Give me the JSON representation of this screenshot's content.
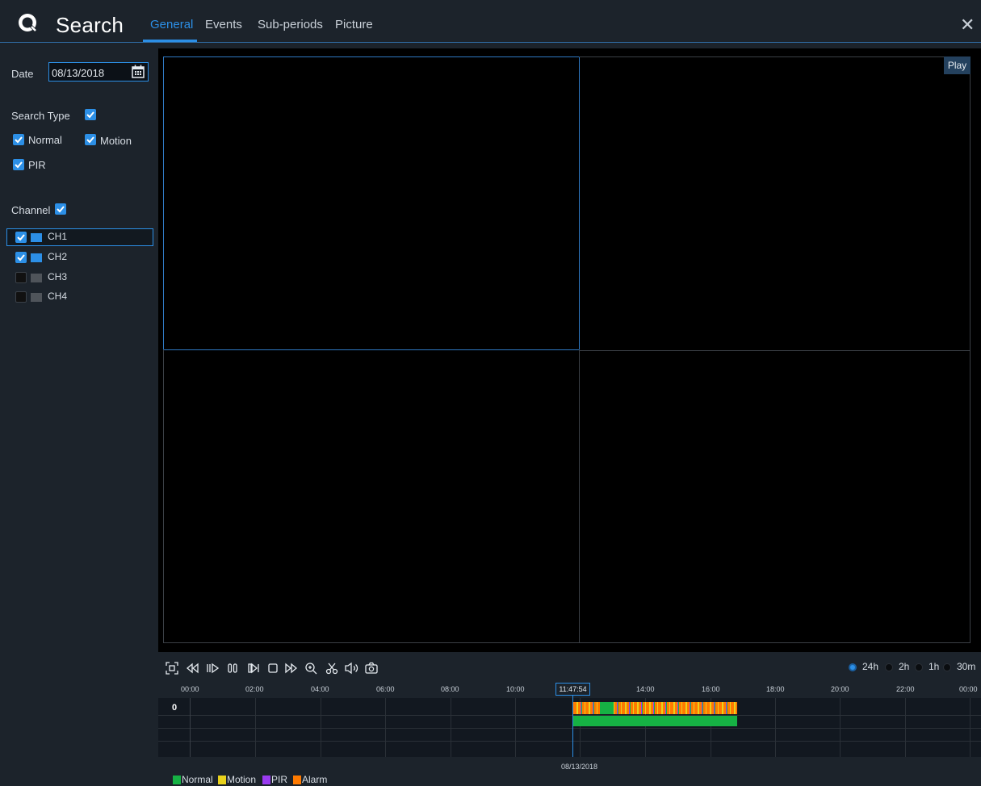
{
  "header": {
    "title": "Search",
    "tabs": [
      "General",
      "Events",
      "Sub-periods",
      "Picture"
    ],
    "active_tab": "General",
    "close_symbol": "✕"
  },
  "sidebar": {
    "date_label": "Date",
    "date_value": "08/13/2018",
    "search_type_label": "Search Type",
    "search_type_checked": true,
    "types": [
      {
        "label": "Normal",
        "checked": true
      },
      {
        "label": "Motion",
        "checked": true
      },
      {
        "label": "PIR",
        "checked": true
      }
    ],
    "channel_label": "Channel",
    "channel_checked": true,
    "channels": [
      {
        "label": "CH1",
        "checked": true,
        "selected": true
      },
      {
        "label": "CH2",
        "checked": true,
        "selected": false
      },
      {
        "label": "CH3",
        "checked": false,
        "selected": false
      },
      {
        "label": "CH4",
        "checked": false,
        "selected": false
      }
    ]
  },
  "player": {
    "play_label": "Play",
    "controls": [
      "fullscreen-icon",
      "rewind-icon",
      "play-icon",
      "pause-icon",
      "step-frame-icon",
      "stop-icon",
      "fast-forward-icon",
      "zoom-icon",
      "clip-icon",
      "volume-icon",
      "snapshot-icon"
    ]
  },
  "timeline": {
    "scale_options": [
      {
        "label": "24h",
        "selected": true
      },
      {
        "label": "2h",
        "selected": false
      },
      {
        "label": "1h",
        "selected": false
      },
      {
        "label": "30m",
        "selected": false
      }
    ],
    "ticks": [
      "00:00",
      "02:00",
      "04:00",
      "06:00",
      "08:00",
      "10:00",
      "11:47:54",
      "14:00",
      "16:00",
      "18:00",
      "20:00",
      "22:00",
      "00:00"
    ],
    "current_time": "11:47:54",
    "channel_marker": "0",
    "date": "08/13/2018",
    "legend": [
      {
        "label": "Normal",
        "color": "#16b244"
      },
      {
        "label": "Motion",
        "color": "#e9d21c"
      },
      {
        "label": "PIR",
        "color": "#9a3bf0"
      },
      {
        "label": "Alarm",
        "color": "#ff7a00"
      }
    ]
  }
}
